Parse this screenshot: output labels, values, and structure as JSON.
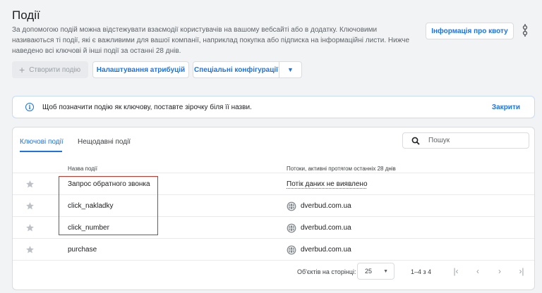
{
  "page": {
    "title": "Події",
    "description": "За допомогою подій можна відстежувати взаємодії користувачів на вашому вебсайті або в додатку. Ключовими називаються ті події, які є важливими для вашої компанії, наприклад покупка або підписка на інформаційні листи. Нижче наведено всі ключові й інші події за останні 28 днів."
  },
  "toolbar": {
    "quota_label": "Інформація про квоту",
    "create_label": "Створити подію",
    "attribution_label": "Налаштування атрибуцій",
    "special_config_label": "Спеціальні конфігурації"
  },
  "banner": {
    "message": "Щоб позначити подію як ключову, поставте зірочку біля її назви.",
    "close_label": "Закрити"
  },
  "tabs": [
    {
      "label": "Ключові події",
      "active": true
    },
    {
      "label": "Нещодавні події",
      "active": false
    }
  ],
  "search": {
    "placeholder": "Пошук"
  },
  "table": {
    "columns": [
      "Назва події",
      "Потоки, активні протягом останніх 28 днів"
    ],
    "rows": [
      {
        "name": "Запрос обратного звонка",
        "stream": "Потік даних не виявлено",
        "has_stream": false
      },
      {
        "name": "click_nakladky",
        "stream": "dverbud.com.ua",
        "has_stream": true
      },
      {
        "name": "click_number",
        "stream": "dverbud.com.ua",
        "has_stream": true
      },
      {
        "name": "purchase",
        "stream": "dverbud.com.ua",
        "has_stream": true
      }
    ]
  },
  "pagination": {
    "rows_per_page_label": "Об'єктів на сторінці:",
    "rows_per_page_value": "25",
    "range_label": "1–4 з 4"
  },
  "colors": {
    "accent": "#1a73e8",
    "highlight": "#d93025",
    "star": "#bdc1c6"
  }
}
